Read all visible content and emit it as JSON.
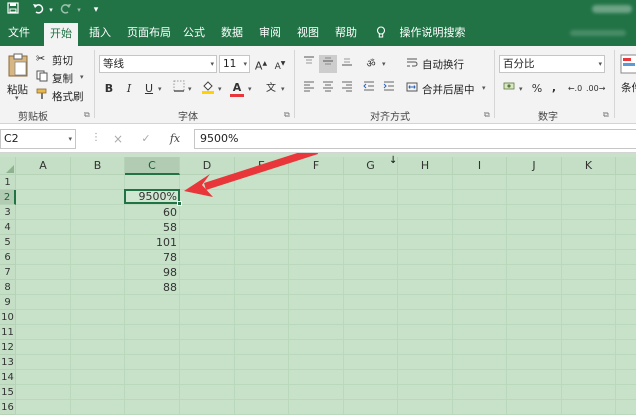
{
  "quick_access": {
    "save_icon": "save-icon",
    "undo_icon": "undo-icon",
    "redo_icon": "redo-icon",
    "customize_icon": "customize-icon"
  },
  "tabs": [
    {
      "label": "文件",
      "active": false
    },
    {
      "label": "开始",
      "active": true
    },
    {
      "label": "插入",
      "active": false
    },
    {
      "label": "页面布局",
      "active": false
    },
    {
      "label": "公式",
      "active": false
    },
    {
      "label": "数据",
      "active": false
    },
    {
      "label": "审阅",
      "active": false
    },
    {
      "label": "视图",
      "active": false
    },
    {
      "label": "帮助",
      "active": false
    }
  ],
  "tell_me": "操作说明搜索",
  "ribbon": {
    "clipboard": {
      "paste": "粘贴",
      "cut": "剪切",
      "copy": "复制",
      "format_painter": "格式刷",
      "label": "剪贴板"
    },
    "font": {
      "name": "等线",
      "size": "11",
      "grow": "A",
      "shrink": "A",
      "bold": "B",
      "italic": "I",
      "underline": "U",
      "color_letter": "A",
      "phonetic": "文",
      "label": "字体"
    },
    "alignment": {
      "wrap": "自动换行",
      "merge": "合并后居中",
      "label": "对齐方式"
    },
    "number": {
      "format": "百分比",
      "percent": "%",
      "comma": ",",
      "label": "数字"
    },
    "styles": {
      "cond_partial": "条件"
    }
  },
  "formula_bar": {
    "name_box": "C2",
    "cancel": "×",
    "enter": "✓",
    "fx": "fx",
    "value": "9500%"
  },
  "grid": {
    "columns": [
      "A",
      "B",
      "C",
      "D",
      "E",
      "F",
      "G",
      "H",
      "I",
      "J",
      "K"
    ],
    "selected_column": "C",
    "rows": [
      "1",
      "2",
      "3",
      "4",
      "5",
      "6",
      "7",
      "8",
      "9",
      "10",
      "11",
      "12",
      "13",
      "14",
      "15",
      "16"
    ],
    "selected_row": "2",
    "column_c_values": [
      "",
      "9500%",
      "60",
      "58",
      "101",
      "78",
      "98",
      "88"
    ]
  },
  "colors": {
    "excel_green": "#217346",
    "arrow_red": "#e8363b",
    "grid_green": "#c7e2c9",
    "ribbon_bg": "#f3f3f3"
  }
}
